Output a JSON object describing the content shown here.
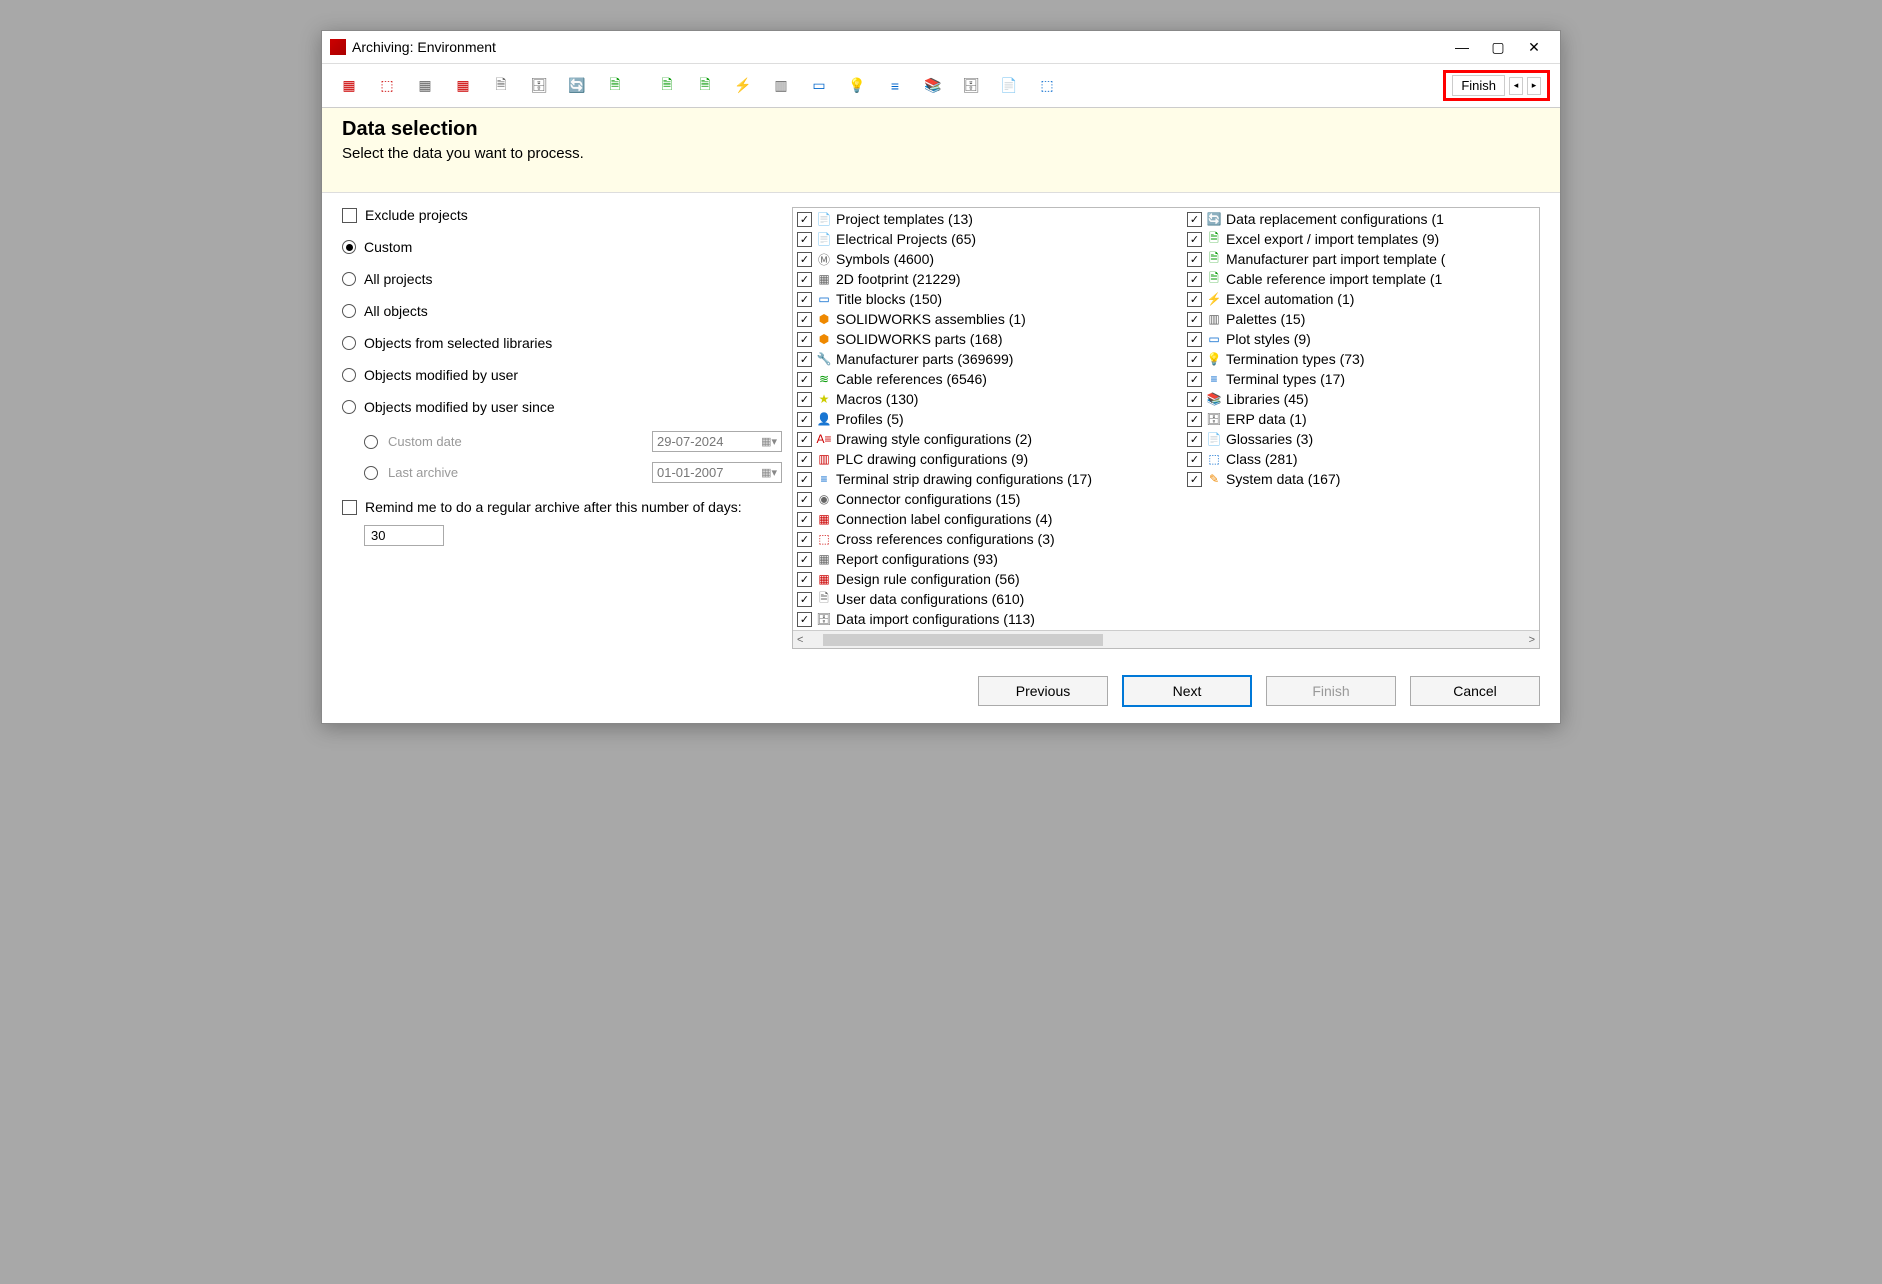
{
  "window": {
    "title": "Archiving: Environment"
  },
  "toolbar": {
    "finish_label": "Finish"
  },
  "header": {
    "title": "Data selection",
    "subtitle": "Select the data you want to process."
  },
  "left": {
    "exclude_projects": "Exclude projects",
    "radio": {
      "custom": "Custom",
      "all_projects": "All projects",
      "all_objects": "All objects",
      "from_libraries": "Objects from selected libraries",
      "by_user": "Objects modified by user",
      "by_user_since": "Objects modified by user since"
    },
    "custom_date_label": "Custom date",
    "custom_date_value": "29-07-2024",
    "last_archive_label": "Last archive",
    "last_archive_value": "01-01-2007",
    "remind_label": "Remind me to do a regular archive after this number of days:",
    "remind_days": "30"
  },
  "tree_col_a": [
    {
      "label": "Project templates (13)",
      "icon": "📄",
      "cls": "ic-gray"
    },
    {
      "label": "Electrical Projects (65)",
      "icon": "📄",
      "cls": "ic-gray"
    },
    {
      "label": "Symbols (4600)",
      "icon": "Ⓜ",
      "cls": "ic-gray"
    },
    {
      "label": "2D footprint (21229)",
      "icon": "▦",
      "cls": "ic-gray"
    },
    {
      "label": "Title blocks (150)",
      "icon": "▭",
      "cls": "ic-blue"
    },
    {
      "label": "SOLIDWORKS assemblies (1)",
      "icon": "⬢",
      "cls": "ic-orange"
    },
    {
      "label": "SOLIDWORKS parts (168)",
      "icon": "⬢",
      "cls": "ic-orange"
    },
    {
      "label": "Manufacturer parts (369699)",
      "icon": "🔧",
      "cls": "ic-gray"
    },
    {
      "label": "Cable references (6546)",
      "icon": "≋",
      "cls": "ic-green"
    },
    {
      "label": "Macros (130)",
      "icon": "★",
      "cls": "ic-yellow"
    },
    {
      "label": "Profiles (5)",
      "icon": "👤",
      "cls": "ic-gray"
    },
    {
      "label": "Drawing style configurations (2)",
      "icon": "A≡",
      "cls": "ic-red"
    },
    {
      "label": "PLC drawing configurations (9)",
      "icon": "▥",
      "cls": "ic-red"
    },
    {
      "label": "Terminal strip drawing configurations (17)",
      "icon": "≡",
      "cls": "ic-blue"
    },
    {
      "label": "Connector configurations (15)",
      "icon": "◉",
      "cls": "ic-gray"
    },
    {
      "label": "Connection label configurations (4)",
      "icon": "▦",
      "cls": "ic-red"
    },
    {
      "label": "Cross references configurations (3)",
      "icon": "⬚",
      "cls": "ic-red"
    },
    {
      "label": "Report configurations (93)",
      "icon": "▦",
      "cls": "ic-gray"
    },
    {
      "label": "Design rule configuration (56)",
      "icon": "▦",
      "cls": "ic-red"
    },
    {
      "label": "User data configurations (610)",
      "icon": "🗎",
      "cls": "ic-gray"
    },
    {
      "label": "Data import configurations (113)",
      "icon": "🗄",
      "cls": "ic-gray"
    }
  ],
  "tree_col_b": [
    {
      "label": "Data replacement configurations (1",
      "icon": "🔄",
      "cls": "ic-blue"
    },
    {
      "label": "Excel export / import templates (9)",
      "icon": "🗎",
      "cls": "ic-green"
    },
    {
      "label": "Manufacturer part import template (",
      "icon": "🗎",
      "cls": "ic-green"
    },
    {
      "label": "Cable reference import template (1",
      "icon": "🗎",
      "cls": "ic-green"
    },
    {
      "label": "Excel automation (1)",
      "icon": "⚡",
      "cls": "ic-orange"
    },
    {
      "label": "Palettes (15)",
      "icon": "▥",
      "cls": "ic-gray"
    },
    {
      "label": "Plot styles (9)",
      "icon": "▭",
      "cls": "ic-blue"
    },
    {
      "label": "Termination types (73)",
      "icon": "💡",
      "cls": "ic-yellow"
    },
    {
      "label": "Terminal types (17)",
      "icon": "≡",
      "cls": "ic-blue"
    },
    {
      "label": "Libraries (45)",
      "icon": "📚",
      "cls": "ic-gray"
    },
    {
      "label": "ERP data (1)",
      "icon": "🗄",
      "cls": "ic-gray"
    },
    {
      "label": "Glossaries (3)",
      "icon": "📄",
      "cls": "ic-gray"
    },
    {
      "label": "Class (281)",
      "icon": "⬚",
      "cls": "ic-blue"
    },
    {
      "label": "System data (167)",
      "icon": "✎",
      "cls": "ic-orange"
    }
  ],
  "footer": {
    "previous": "Previous",
    "next": "Next",
    "finish": "Finish",
    "cancel": "Cancel"
  }
}
